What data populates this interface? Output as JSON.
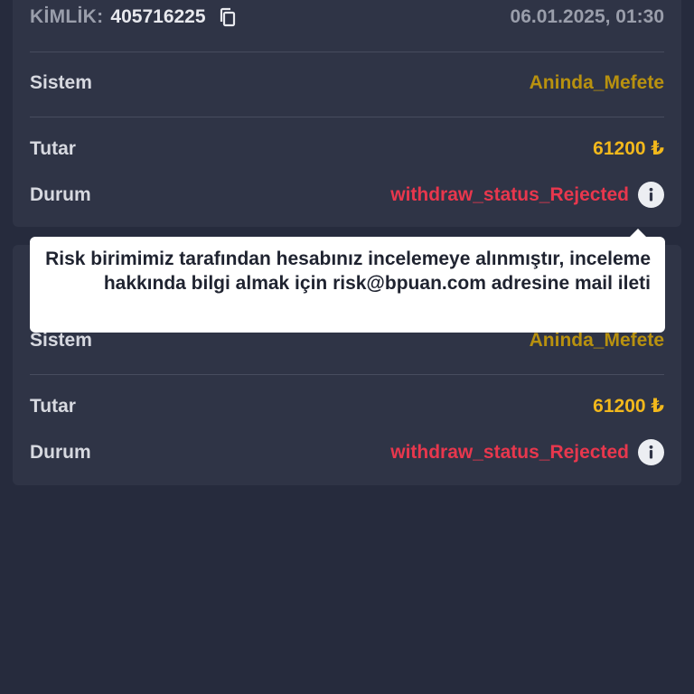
{
  "transactions": [
    {
      "id_label": "KİMLİK:",
      "id_value": "405716225",
      "date": "06.01.2025, 01:30",
      "system_label": "Sistem",
      "system_value": "Aninda_Mefete",
      "amount_label": "Tutar",
      "amount_value": "61200 ₺",
      "status_label": "Durum",
      "status_value": "withdraw_status_Rejected"
    },
    {
      "system_label": "Sistem",
      "system_value": "Aninda_Mefete",
      "amount_label": "Tutar",
      "amount_value": "61200 ₺",
      "status_label": "Durum",
      "status_value": "withdraw_status_Rejected"
    }
  ],
  "tooltip": {
    "text": "Risk birimimiz tarafından hesabınız incelemeye alınmıştır, inceleme hakkında bilgi almak için risk@bpuan.com adresine mail ileti"
  },
  "colors": {
    "background": "#262b3d",
    "card": "#2f3446",
    "system_value": "#b8910f",
    "amount": "#f2b81c",
    "status_rejected": "#e8374d"
  },
  "icons": {
    "copy": "copy-icon",
    "info": "info-icon"
  }
}
